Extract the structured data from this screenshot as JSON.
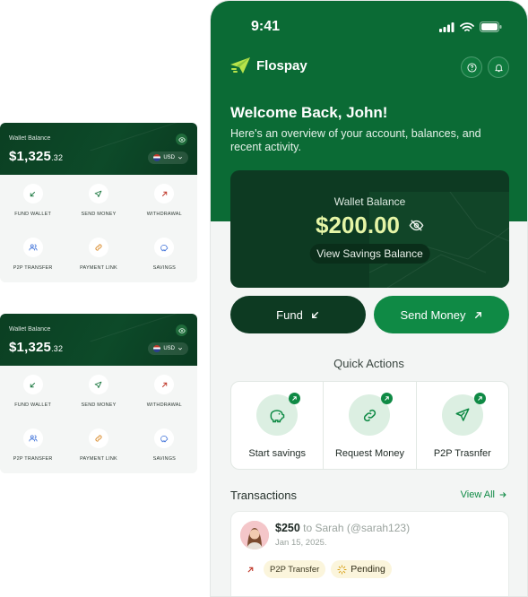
{
  "wallet_cards": [
    {
      "label": "Wallet Balance",
      "amount_main": "$1,325",
      "amount_decimal": ".32",
      "currency": "USD",
      "actions": [
        {
          "label": "FUND WALLET",
          "icon": "arrow-down-left-icon",
          "color": "#1f7a43"
        },
        {
          "label": "SEND MONEY",
          "icon": "send-icon",
          "color": "#1f7a43"
        },
        {
          "label": "WITHDRAWAL",
          "icon": "arrow-up-right-icon",
          "color": "#c0392b"
        },
        {
          "label": "P2P TRANSFER",
          "icon": "users-icon",
          "color": "#3b6fd8"
        },
        {
          "label": "PAYMENT LINK",
          "icon": "link-icon",
          "color": "#d98b2b"
        },
        {
          "label": "SAVINGS",
          "icon": "piggy-bank-icon",
          "color": "#3b6fd8"
        }
      ]
    },
    {
      "label": "Wallet Balance",
      "amount_main": "$1,325",
      "amount_decimal": ".32",
      "currency": "USD",
      "actions": [
        {
          "label": "FUND WALLET",
          "icon": "arrow-down-left-icon",
          "color": "#1f7a43"
        },
        {
          "label": "SEND MONEY",
          "icon": "send-icon",
          "color": "#1f7a43"
        },
        {
          "label": "WITHDRAWAL",
          "icon": "arrow-up-right-icon",
          "color": "#c0392b"
        },
        {
          "label": "P2P TRANSFER",
          "icon": "users-icon",
          "color": "#3b6fd8"
        },
        {
          "label": "PAYMENT LINK",
          "icon": "link-icon",
          "color": "#d98b2b"
        },
        {
          "label": "SAVINGS",
          "icon": "piggy-bank-icon",
          "color": "#3b6fd8"
        }
      ]
    }
  ],
  "phone": {
    "status_time": "9:41",
    "brand_name": "Flospay",
    "welcome_title": "Welcome Back, John!",
    "welcome_subtitle": "Here's an overview of your account, balances, and recent activity.",
    "balance": {
      "label": "Wallet Balance",
      "amount": "$200.00",
      "savings_link": "View Savings Balance"
    },
    "buttons": {
      "fund": "Fund",
      "send": "Send Money"
    },
    "quick_actions": {
      "title": "Quick Actions",
      "items": [
        {
          "label": "Start savings",
          "icon": "piggy-bank-icon"
        },
        {
          "label": "Request Money",
          "icon": "link-icon"
        },
        {
          "label": "P2P Trasnfer",
          "icon": "send-icon"
        }
      ]
    },
    "transactions": {
      "title": "Transactions",
      "view_all": "View All",
      "items": [
        {
          "amount": "$250",
          "recipient": "to Sarah (@sarah123)",
          "date": "Jan 15, 2025.",
          "type": "P2P Transfer",
          "status": "Pending"
        }
      ]
    },
    "colors": {
      "primary": "#0b6b35",
      "primary_dark": "#0d3a22",
      "accent": "#0f8a45",
      "balance_highlight": "#e5f5a6",
      "brand_logo": "#b7e34a"
    }
  }
}
